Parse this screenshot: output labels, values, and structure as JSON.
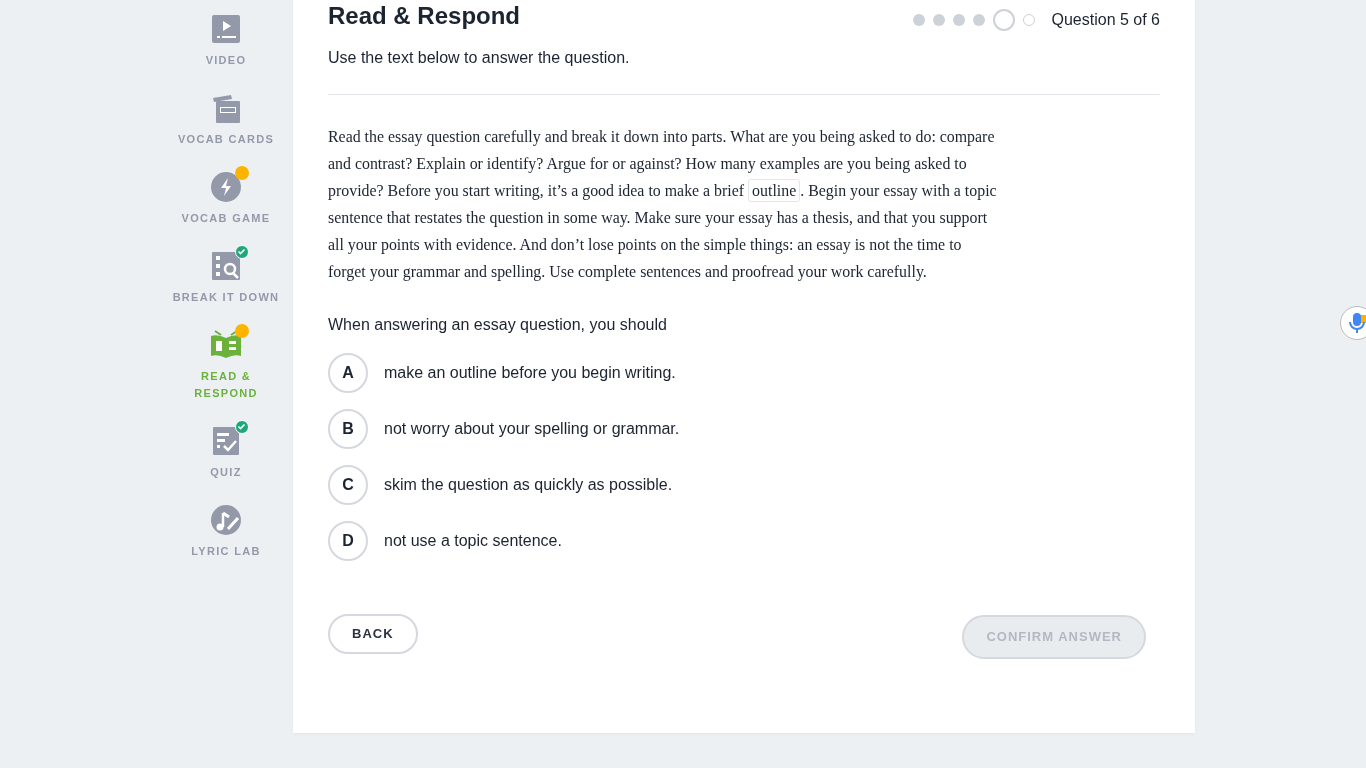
{
  "sidebar": {
    "items": [
      {
        "label": "VIDEO",
        "new": false,
        "completed": false,
        "selected": false
      },
      {
        "label": "VOCAB CARDS",
        "new": false,
        "completed": false,
        "selected": false
      },
      {
        "label": "VOCAB GAME",
        "new": true,
        "completed": false,
        "selected": false
      },
      {
        "label": "BREAK IT DOWN",
        "new": false,
        "completed": true,
        "selected": false
      },
      {
        "label": "READ & RESPOND",
        "new": true,
        "completed": false,
        "selected": true
      },
      {
        "label": "QUIZ",
        "new": false,
        "completed": true,
        "selected": false
      },
      {
        "label": "LYRIC LAB",
        "new": false,
        "completed": false,
        "selected": false
      }
    ]
  },
  "header": {
    "title": "Read & Respond",
    "subtitle": "Use the text below to answer the question.",
    "progress_label": "Question 5 of 6",
    "steps": [
      {
        "completed": true,
        "selected": false
      },
      {
        "completed": true,
        "selected": false
      },
      {
        "completed": true,
        "selected": false
      },
      {
        "completed": true,
        "selected": false
      },
      {
        "completed": false,
        "selected": true
      },
      {
        "completed": false,
        "selected": false
      }
    ]
  },
  "passage": [
    {
      "kind": "text",
      "text": "Read the essay question carefully and break it down into parts. What are you being asked to do: compare and contrast? Explain or identify? Argue for or against? How many examples are you being asked to provide? Before you start writing, it’s a good idea to make a brief "
    },
    {
      "kind": "term",
      "text": "outline"
    },
    {
      "kind": "text",
      "text": ". Begin your essay with a topic sentence that restates the question in some way. Make sure your essay has a thesis, and that you support all your points with evidence. And don’t lose points on the simple things: an essay is not the time to forget your grammar and spelling. Use complete sentences and proofread your work carefully."
    }
  ],
  "question": "When answering an essay question, you should",
  "options": [
    {
      "letter": "A",
      "text": "make an outline before you begin writing.",
      "selected": false
    },
    {
      "letter": "B",
      "text": "not worry about your spelling or grammar.",
      "selected": false
    },
    {
      "letter": "C",
      "text": "skim the question as quickly as possible.",
      "selected": false
    },
    {
      "letter": "D",
      "text": "not use a topic sentence.",
      "selected": false
    }
  ],
  "buttons": {
    "back": {
      "label": "BACK"
    },
    "confirm": {
      "label": "CONFIRM ANSWER",
      "disabled": true
    }
  }
}
